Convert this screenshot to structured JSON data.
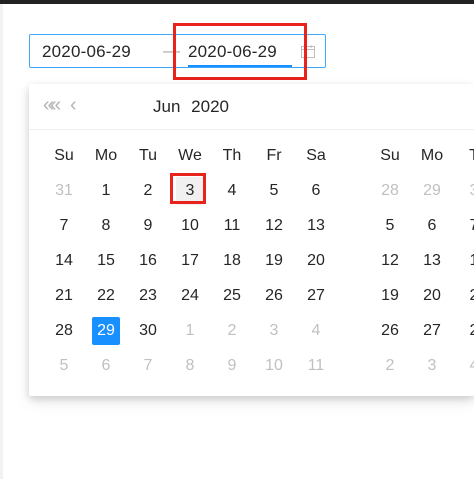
{
  "range_input": {
    "start_value": "2020-06-29",
    "separator": "—",
    "end_value": "2020-06-29",
    "icon": "calendar-icon"
  },
  "panel": {
    "nav": {
      "super_prev": "«",
      "prev": "‹"
    },
    "header": {
      "month": "Jun",
      "year": "2020"
    },
    "weekdays": [
      "Su",
      "Mo",
      "Tu",
      "We",
      "Th",
      "Fr",
      "Sa"
    ],
    "left_month": {
      "weeks": [
        [
          {
            "d": "31",
            "m": true
          },
          {
            "d": "1"
          },
          {
            "d": "2"
          },
          {
            "d": "3",
            "hover": true,
            "boxed": true
          },
          {
            "d": "4"
          },
          {
            "d": "5"
          },
          {
            "d": "6"
          }
        ],
        [
          {
            "d": "7"
          },
          {
            "d": "8"
          },
          {
            "d": "9"
          },
          {
            "d": "10"
          },
          {
            "d": "11"
          },
          {
            "d": "12"
          },
          {
            "d": "13"
          }
        ],
        [
          {
            "d": "14"
          },
          {
            "d": "15"
          },
          {
            "d": "16"
          },
          {
            "d": "17"
          },
          {
            "d": "18"
          },
          {
            "d": "19"
          },
          {
            "d": "20"
          }
        ],
        [
          {
            "d": "21"
          },
          {
            "d": "22"
          },
          {
            "d": "23"
          },
          {
            "d": "24"
          },
          {
            "d": "25"
          },
          {
            "d": "26"
          },
          {
            "d": "27"
          }
        ],
        [
          {
            "d": "28"
          },
          {
            "d": "29",
            "selected": true
          },
          {
            "d": "30"
          },
          {
            "d": "1",
            "m": true
          },
          {
            "d": "2",
            "m": true
          },
          {
            "d": "3",
            "m": true
          },
          {
            "d": "4",
            "m": true
          }
        ],
        [
          {
            "d": "5",
            "m": true
          },
          {
            "d": "6",
            "m": true
          },
          {
            "d": "7",
            "m": true
          },
          {
            "d": "8",
            "m": true
          },
          {
            "d": "9",
            "m": true
          },
          {
            "d": "10",
            "m": true
          },
          {
            "d": "11",
            "m": true
          }
        ]
      ]
    },
    "right_month": {
      "weekdays_visible": [
        "Su",
        "Mo",
        "T"
      ],
      "weeks": [
        [
          {
            "d": "28",
            "m": true
          },
          {
            "d": "29",
            "m": true
          },
          {
            "d": "3",
            "m": true
          }
        ],
        [
          {
            "d": "5"
          },
          {
            "d": "6"
          },
          {
            "d": "7"
          }
        ],
        [
          {
            "d": "12"
          },
          {
            "d": "13"
          },
          {
            "d": "1"
          }
        ],
        [
          {
            "d": "19"
          },
          {
            "d": "20"
          },
          {
            "d": "2"
          }
        ],
        [
          {
            "d": "26"
          },
          {
            "d": "27"
          },
          {
            "d": "2"
          }
        ],
        [
          {
            "d": "2",
            "m": true
          },
          {
            "d": "3",
            "m": true
          },
          {
            "d": "4",
            "m": true
          }
        ]
      ]
    }
  },
  "colors": {
    "accent": "#1890ff",
    "highlight_box": "#e8231b",
    "muted_text": "#c0c0c0"
  }
}
